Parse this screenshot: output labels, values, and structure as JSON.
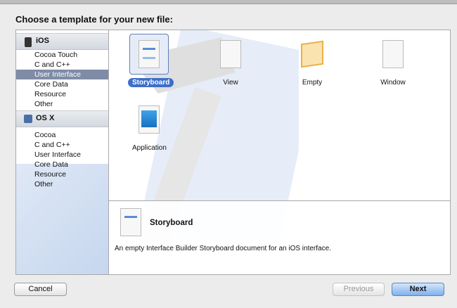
{
  "title": "Choose a template for your new file:",
  "sidebar": {
    "groups": [
      {
        "label": "iOS",
        "items": [
          "Cocoa Touch",
          "C and C++",
          "User Interface",
          "Core Data",
          "Resource",
          "Other"
        ]
      },
      {
        "label": "OS X",
        "items": [
          "Cocoa",
          "C and C++",
          "User Interface",
          "Core Data",
          "Resource",
          "Other"
        ]
      }
    ],
    "selected": "iOS / User Interface"
  },
  "templates": [
    "Storyboard",
    "View",
    "Empty",
    "Window",
    "Application"
  ],
  "selected_template": "Storyboard",
  "description": {
    "title": "Storyboard",
    "text": "An empty Interface Builder Storyboard document for an iOS interface."
  },
  "buttons": {
    "cancel": "Cancel",
    "previous": "Previous",
    "next": "Next"
  }
}
